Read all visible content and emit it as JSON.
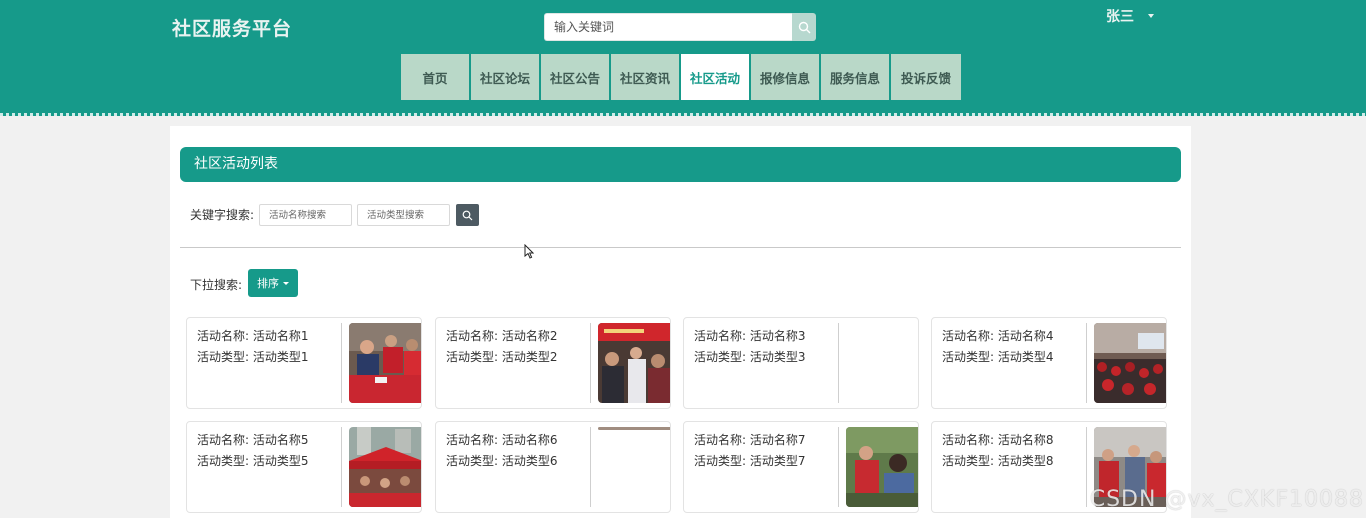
{
  "site": {
    "title": "社区服务平台"
  },
  "search": {
    "placeholder": "输入关键词"
  },
  "user": {
    "name": "张三"
  },
  "nav": {
    "items": [
      {
        "label": "首页",
        "active": false
      },
      {
        "label": "社区论坛",
        "active": false
      },
      {
        "label": "社区公告",
        "active": false
      },
      {
        "label": "社区资讯",
        "active": false
      },
      {
        "label": "社区活动",
        "active": true
      },
      {
        "label": "报修信息",
        "active": false
      },
      {
        "label": "服务信息",
        "active": false
      },
      {
        "label": "投诉反馈",
        "active": false
      }
    ]
  },
  "page": {
    "section_title": "社区活动列表",
    "keyword_label": "关键字搜索:",
    "name_placeholder": "活动名称搜索",
    "type_placeholder": "活动类型搜索",
    "dropdown_label": "下拉搜索:",
    "sort_label": "排序"
  },
  "activities": [
    {
      "name_line": "活动名称: 活动名称1",
      "type_line": "活动类型: 活动类型1",
      "image": "volunteers-at-red-table-photo"
    },
    {
      "name_line": "活动名称: 活动名称2",
      "type_line": "活动类型: 活动类型2",
      "image": "red-banner-crowd-photo"
    },
    {
      "name_line": "活动名称: 活动名称3",
      "type_line": "活动类型: 活动类型3",
      "image": ""
    },
    {
      "name_line": "活动名称: 活动名称4",
      "type_line": "活动类型: 活动类型4",
      "image": "meeting-hall-audience-photo"
    },
    {
      "name_line": "活动名称: 活动名称5",
      "type_line": "活动类型: 活动类型5",
      "image": "red-tent-outdoor-photo"
    },
    {
      "name_line": "活动名称: 活动名称6",
      "type_line": "活动类型: 活动类型6",
      "image": ""
    },
    {
      "name_line": "活动名称: 活动名称7",
      "type_line": "活动类型: 活动类型7",
      "image": "outdoor-haircut-service-photo"
    },
    {
      "name_line": "活动名称: 活动名称8",
      "type_line": "活动类型: 活动类型8",
      "image": "indoor-volunteers-photo"
    }
  ],
  "watermark": "CSDN @vx_CXKF10088",
  "colors": {
    "primary": "#169a8a",
    "nav_bg": "#b9d8c8",
    "search_btn": "#b7d8cf",
    "filter_btn": "#4d5a62"
  }
}
